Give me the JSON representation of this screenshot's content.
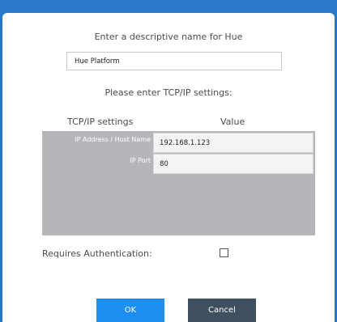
{
  "dialog": {
    "name_prompt": "Enter a descriptive name for Hue",
    "name_value": "Hue Platform",
    "tcp_prompt": "Please enter TCP/IP settings:"
  },
  "settings": {
    "col_setting": "TCP/IP settings",
    "col_value": "Value",
    "rows": [
      {
        "label": "IP Address / Host Name",
        "value": "192.168.1.123"
      },
      {
        "label": "IP Port",
        "value": "80"
      }
    ]
  },
  "auth": {
    "label": "Requires Authentication:",
    "checked": false
  },
  "buttons": {
    "ok": "OK",
    "cancel": "Cancel"
  },
  "colors": {
    "frame": "#2b78c9",
    "ok_button": "#1e8ff0",
    "cancel_button": "#3f4f5f",
    "grid_background": "#b5b6b9"
  }
}
